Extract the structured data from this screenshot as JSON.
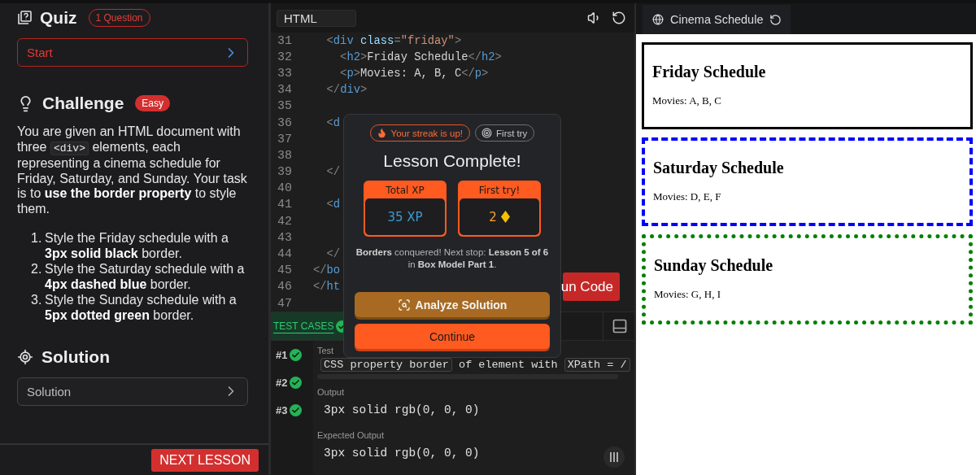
{
  "quiz": {
    "title": "Quiz",
    "badge": "1 Question",
    "start_label": "Start"
  },
  "challenge": {
    "title": "Challenge",
    "difficulty": "Easy",
    "description": [
      {
        "kind": "text",
        "text": "You are given an HTML document with three "
      },
      {
        "kind": "code",
        "text": "<div>"
      },
      {
        "kind": "text",
        "text": " elements, each representing a cinema schedule for Friday, Saturday, and Sunday. Your task is to **use the border property** to style them."
      }
    ],
    "steps": [
      {
        "number": "1.",
        "text": "Style the Friday schedule with a **3px solid black** border."
      },
      {
        "number": "2.",
        "text": "Style the Saturday schedule with a **4px dashed blue** border."
      },
      {
        "number": "3.",
        "text": "Style the Sunday schedule with a **5px dotted green** border."
      }
    ]
  },
  "solution": {
    "title": "Solution",
    "label": "Solution"
  },
  "next_lesson": "NEXT LESSON",
  "editor": {
    "tab": "HTML",
    "run_button": "un Code",
    "lines": [
      {
        "number": "31",
        "tokens": [
          {
            "kind": "punct",
            "text": "  <"
          },
          {
            "kind": "tag",
            "text": "div"
          },
          {
            "kind": "attr",
            "text": " class"
          },
          {
            "kind": "punct",
            "text": "="
          },
          {
            "kind": "string",
            "text": "\"friday\""
          },
          {
            "kind": "punct",
            "text": ">"
          }
        ]
      },
      {
        "number": "32",
        "tokens": [
          {
            "kind": "punct",
            "text": "    <"
          },
          {
            "kind": "tag",
            "text": "h2"
          },
          {
            "kind": "punct",
            "text": ">"
          },
          {
            "kind": "text",
            "text": "Friday Schedule"
          },
          {
            "kind": "punct",
            "text": "</"
          },
          {
            "kind": "tag",
            "text": "h2"
          },
          {
            "kind": "punct",
            "text": ">"
          }
        ]
      },
      {
        "number": "33",
        "tokens": [
          {
            "kind": "punct",
            "text": "    <"
          },
          {
            "kind": "tag",
            "text": "p"
          },
          {
            "kind": "punct",
            "text": ">"
          },
          {
            "kind": "text",
            "text": "Movies: A, B, C"
          },
          {
            "kind": "punct",
            "text": "</"
          },
          {
            "kind": "tag",
            "text": "p"
          },
          {
            "kind": "punct",
            "text": ">"
          }
        ]
      },
      {
        "number": "34",
        "tokens": [
          {
            "kind": "punct",
            "text": "  </"
          },
          {
            "kind": "tag",
            "text": "div"
          },
          {
            "kind": "punct",
            "text": ">"
          }
        ]
      },
      {
        "number": "35"
      },
      {
        "number": "36",
        "tokens": [
          {
            "kind": "punct",
            "text": "  <"
          },
          {
            "kind": "tag",
            "text": "d"
          }
        ]
      },
      {
        "number": "37"
      },
      {
        "number": "38"
      },
      {
        "number": "39",
        "tokens": [
          {
            "kind": "punct",
            "text": "  </"
          }
        ]
      },
      {
        "number": "40"
      },
      {
        "number": "41",
        "tokens": [
          {
            "kind": "punct",
            "text": "  <"
          },
          {
            "kind": "tag",
            "text": "d"
          }
        ]
      },
      {
        "number": "42"
      },
      {
        "number": "43"
      },
      {
        "number": "44",
        "tokens": [
          {
            "kind": "punct",
            "text": "  </"
          }
        ]
      },
      {
        "number": "45",
        "tokens": [
          {
            "kind": "punct",
            "text": "</"
          },
          {
            "kind": "tag",
            "text": "bo"
          }
        ]
      },
      {
        "number": "46",
        "tokens": [
          {
            "kind": "punct",
            "text": "</"
          },
          {
            "kind": "tag",
            "text": "ht"
          }
        ]
      },
      {
        "number": "47"
      }
    ]
  },
  "test_cases": {
    "tab": "TEST CASES",
    "passed": true,
    "items": [
      {
        "label": "#1",
        "passed": true
      },
      {
        "label": "#2",
        "passed": true
      },
      {
        "label": "#3",
        "passed": true
      }
    ],
    "test_label": "Test",
    "test_text": [
      {
        "kind": "chip",
        "text": "CSS property border"
      },
      {
        "kind": "plain",
        "text": " of element with "
      },
      {
        "kind": "chip",
        "text": "XPath = /"
      }
    ],
    "output_label": "Output",
    "output": "3px solid rgb(0, 0, 0)",
    "expected_label": "Expected Output",
    "expected": "3px solid rgb(0, 0, 0)"
  },
  "modal": {
    "badges": [
      {
        "kind": "streak",
        "label": "Your streak is up!"
      },
      {
        "kind": "first-try",
        "label": "First try"
      }
    ],
    "title": "Lesson Complete!",
    "stats": [
      {
        "kind": "xp",
        "label": "Total XP",
        "value": "35 XP"
      },
      {
        "kind": "gems",
        "label": "First try!",
        "value": "2"
      }
    ],
    "message": "**Borders** conquered! Next stop: **Lesson 5 of 6** in **Box Model Part 1**.",
    "buttons": [
      {
        "kind": "analyze",
        "label": "Analyze Solution"
      },
      {
        "kind": "continue",
        "label": "Continue"
      }
    ]
  },
  "preview": {
    "tab": "Cinema Schedule",
    "sections": [
      {
        "heading": "Friday Schedule",
        "text": "Movies: A, B, C",
        "kind": "solid",
        "color": "#000000"
      },
      {
        "heading": "Saturday Schedule",
        "text": "Movies: D, E, F",
        "kind": "dashed",
        "color": "#0000ff"
      },
      {
        "heading": "Sunday Schedule",
        "text": "Movies: G, H, I",
        "kind": "dotted",
        "color": "#008000"
      }
    ]
  }
}
